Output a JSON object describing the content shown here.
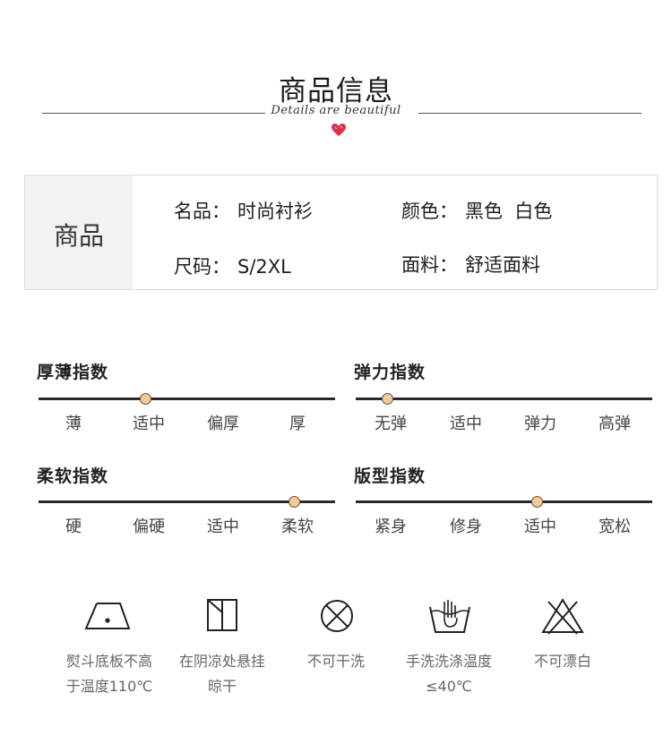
{
  "header": {
    "title": "商品信息",
    "subtitle": "Details are beautiful"
  },
  "info": {
    "section_label": "商品",
    "items": [
      {
        "key": "名品：",
        "value": "时尚衬衫"
      },
      {
        "key": "颜色：",
        "value": "黑色  白色"
      },
      {
        "key": "尺码：",
        "value": "S/2XL"
      },
      {
        "key": "面料：",
        "value": "舒适面料"
      }
    ]
  },
  "indices": [
    {
      "title": "厚薄指数",
      "labels": [
        "薄",
        "适中",
        "偏厚",
        "厚"
      ],
      "selected": "适中",
      "level": 1
    },
    {
      "title": "弹力指数",
      "labels": [
        "无弹",
        "适中",
        "弹力",
        "高弹"
      ],
      "selected": "无弹",
      "level": 0
    },
    {
      "title": "柔软指数",
      "labels": [
        "硬",
        "偏硬",
        "适中",
        "柔软"
      ],
      "selected": "柔软",
      "level": 3
    },
    {
      "title": "版型指数",
      "labels": [
        "紧身",
        "修身",
        "适中",
        "宽松"
      ],
      "selected": "适中",
      "level": 2
    }
  ],
  "care": [
    {
      "icon": "iron-icon",
      "line1": "熨斗底板不高",
      "line2": "于温度110℃"
    },
    {
      "icon": "hang-dry-shade-icon",
      "line1": "在阴凉处悬挂",
      "line2": "晾干"
    },
    {
      "icon": "no-dry-clean-icon",
      "line1": "不可干洗",
      "line2": ""
    },
    {
      "icon": "hand-wash-icon",
      "line1": "手洗洗涤温度",
      "line2": "≤40℃"
    },
    {
      "icon": "no-bleach-icon",
      "line1": "不可漂白",
      "line2": ""
    }
  ],
  "colors": {
    "accent_heart": "#d8344a",
    "dot_fill": "#f0c9a0",
    "track": "#2a2a2a"
  }
}
